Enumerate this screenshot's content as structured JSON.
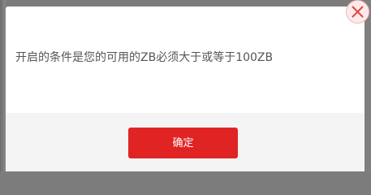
{
  "dialog": {
    "message": "开启的条件是您的可用的ZB必须大于或等于100ZB",
    "confirm_label": "确定"
  },
  "close_icon": "close-icon",
  "colors": {
    "accent": "#e02424",
    "close_icon": "#e0483e",
    "overlay": "#7c7c7c",
    "footer": "#f4f4f4",
    "text": "#555555"
  }
}
